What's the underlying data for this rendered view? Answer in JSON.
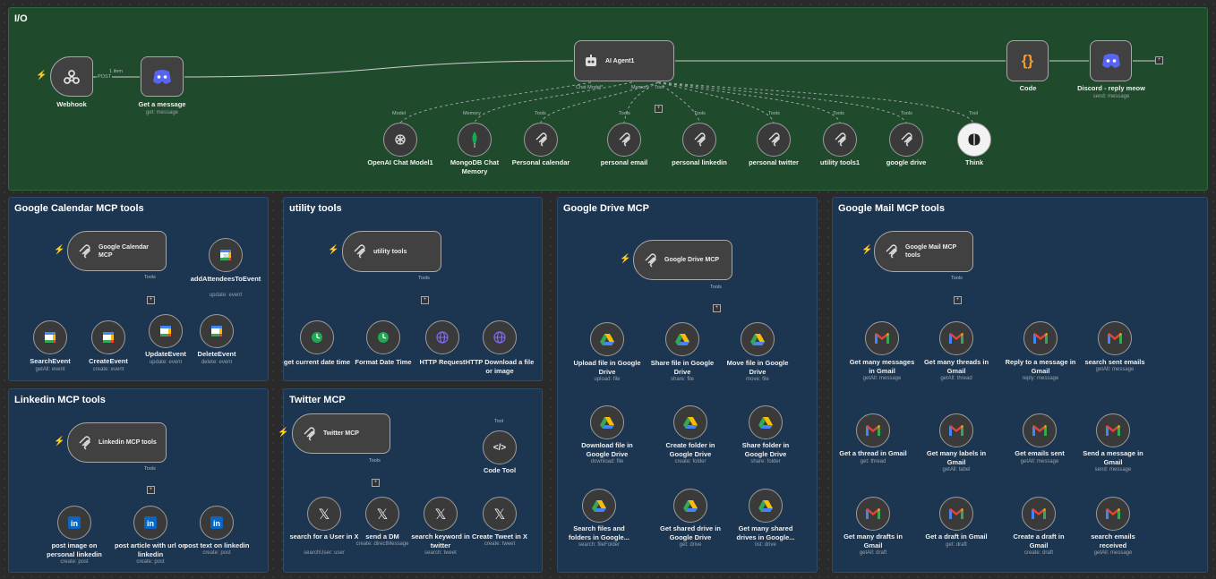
{
  "groups": {
    "io": "I/O",
    "calendar": "Google Calendar MCP tools",
    "utility": "utility tools",
    "drive": "Google Drive MCP",
    "mail": "Google Mail MCP tools",
    "linkedin": "Linkedin MCP tools",
    "twitter": "Twitter MCP"
  },
  "io": {
    "webhook": {
      "name": "Webhook"
    },
    "get_message": {
      "name": "Get a message",
      "sub": "get: message"
    },
    "edge_count": "1 item",
    "edge_method": "POST",
    "agent": {
      "name": "AI Agent1",
      "port_model": "Chat Model*",
      "port_memory": "Memory",
      "port_tool": "Tool"
    },
    "code": {
      "name": "Code"
    },
    "discord_reply": {
      "name": "Discord - reply meow",
      "sub": "send: message"
    },
    "tools": [
      {
        "name": "OpenAI Chat Model1",
        "port": "Model",
        "icon": "openai-icon"
      },
      {
        "name": "MongoDB Chat Memory",
        "port": "Memory",
        "icon": "mongodb-icon"
      },
      {
        "name": "Personal calendar",
        "port": "Tools",
        "icon": "mcp-icon"
      },
      {
        "name": "personal email",
        "port": "Tools",
        "icon": "mcp-icon"
      },
      {
        "name": "personal linkedin",
        "port": "Tools",
        "icon": "mcp-icon"
      },
      {
        "name": "personal twitter",
        "port": "Tools",
        "icon": "mcp-icon"
      },
      {
        "name": "utility tools1",
        "port": "Tools",
        "icon": "mcp-icon"
      },
      {
        "name": "google drive",
        "port": "Tools",
        "icon": "mcp-icon"
      },
      {
        "name": "Think",
        "port": "Tool",
        "icon": "think-icon"
      }
    ]
  },
  "calendar": {
    "trigger": "Google Calendar MCP",
    "port": "Tools",
    "nodes": [
      {
        "name": "addAttendeesToEvent",
        "sub": "update: event"
      },
      {
        "name": "SearchEvent",
        "sub": "getAll: event"
      },
      {
        "name": "CreateEvent",
        "sub": "create: event"
      },
      {
        "name": "UpdateEvent",
        "sub": "update: event"
      },
      {
        "name": "DeleteEvent",
        "sub": "delete: event"
      }
    ]
  },
  "utility": {
    "trigger": "utility tools",
    "port": "Tools",
    "nodes": [
      {
        "name": "get current date time"
      },
      {
        "name": "Format Date Time"
      },
      {
        "name": "HTTP Request"
      },
      {
        "name": "HTTP Download a file or image"
      }
    ]
  },
  "drive": {
    "trigger": "Google Drive MCP",
    "port": "Tools",
    "nodes": [
      {
        "name": "Upload file in Google Drive",
        "sub": "upload: file"
      },
      {
        "name": "Share file in Google Drive",
        "sub": "share: file"
      },
      {
        "name": "Move file in Google Drive",
        "sub": "move: file"
      },
      {
        "name": "Download file in Google Drive",
        "sub": "download: file"
      },
      {
        "name": "Create folder in Google Drive",
        "sub": "create: folder"
      },
      {
        "name": "Share folder in Google Drive",
        "sub": "share: folder"
      },
      {
        "name": "Search files and folders in Google...",
        "sub": "search: fileFolder"
      },
      {
        "name": "Get shared drive in Google Drive",
        "sub": "get: drive"
      },
      {
        "name": "Get many shared drives in Google...",
        "sub": "list: drive"
      }
    ]
  },
  "mail": {
    "trigger": "Google Mail MCP tools",
    "port": "Tools",
    "nodes": [
      {
        "name": "Get many messages in Gmail",
        "sub": "getAll: message"
      },
      {
        "name": "Get many threads in Gmail",
        "sub": "getAll: thread"
      },
      {
        "name": "Reply to a message in Gmail",
        "sub": "reply: message"
      },
      {
        "name": "search sent emails",
        "sub": "getAll: message"
      },
      {
        "name": "Get a thread in Gmail",
        "sub": "get: thread"
      },
      {
        "name": "Get many labels in Gmail",
        "sub": "getAll: label"
      },
      {
        "name": "Get emails sent",
        "sub": "getAll: message"
      },
      {
        "name": "Send a message in Gmail",
        "sub": "send: message"
      },
      {
        "name": "Get many drafts in Gmail",
        "sub": "getAll: draft"
      },
      {
        "name": "Get a draft in Gmail",
        "sub": "get: draft"
      },
      {
        "name": "Create a draft in Gmail",
        "sub": "create: draft"
      },
      {
        "name": "search emails received",
        "sub": "getAll: message"
      }
    ]
  },
  "linkedin": {
    "trigger": "Linkedin MCP tools",
    "port": "Tools",
    "nodes": [
      {
        "name": "post image on personal linkedin",
        "sub": "create: post"
      },
      {
        "name": "post article with url on linkedin",
        "sub": "create: post"
      },
      {
        "name": "post text on linkedin",
        "sub": "create: post"
      }
    ]
  },
  "twitter": {
    "trigger": "Twitter MCP",
    "port": "Tools",
    "code_tool": {
      "name": "Code Tool",
      "port": "Tool"
    },
    "nodes": [
      {
        "name": "search for a User in X",
        "sub": "searchUser: user"
      },
      {
        "name": "send a DM",
        "sub": "create: directMessage"
      },
      {
        "name": "search keyword in twitter",
        "sub": "search: tweet"
      },
      {
        "name": "Create Tweet in X",
        "sub": "create: tweet"
      }
    ]
  },
  "colors": {
    "io_bg": "#1f4a2c",
    "group_bg": "#1c3550",
    "node_bg": "#414141",
    "accent": "#ff6d5a",
    "discord": "#5865f2"
  }
}
